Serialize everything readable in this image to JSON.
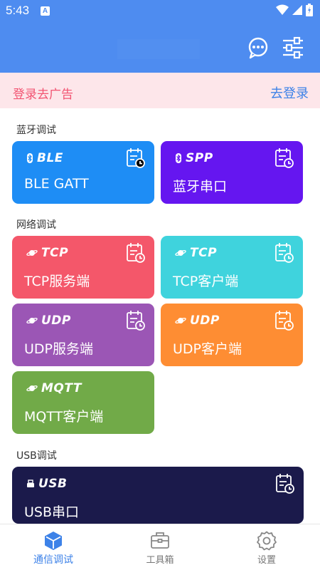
{
  "status_bar": {
    "time": "5:43",
    "notification_badge": "A"
  },
  "app_bar": {
    "title": ""
  },
  "ad_banner": {
    "text": "登录去广告",
    "login_link": "去登录"
  },
  "sections": [
    {
      "title": "蓝牙调试"
    },
    {
      "title": "网络调试"
    },
    {
      "title": "USB调试"
    }
  ],
  "cards": [
    {
      "tag": "BLE",
      "label": "BLE GATT",
      "color": "#1e8df5",
      "tag_icon": "bluetooth-icon"
    },
    {
      "tag": "SPP",
      "label": "蓝牙串口",
      "color": "#6516f0",
      "tag_icon": "bluetooth-icon"
    },
    {
      "tag": "TCP",
      "label": "TCP服务端",
      "color": "#f4576a",
      "tag_icon": "planet-icon"
    },
    {
      "tag": "TCP",
      "label": "TCP客户端",
      "color": "#3fd3dd",
      "tag_icon": "planet-icon"
    },
    {
      "tag": "UDP",
      "label": "UDP服务端",
      "color": "#9b56b5",
      "tag_icon": "planet-icon"
    },
    {
      "tag": "UDP",
      "label": "UDP客户端",
      "color": "#fe8d33",
      "tag_icon": "planet-icon"
    },
    {
      "tag": "MQTT",
      "label": "MQTT客户端",
      "color": "#71aa48",
      "tag_icon": "planet-icon"
    },
    {
      "tag": "USB",
      "label": "USB串口",
      "color": "#1b1a4b",
      "tag_icon": "usb-icon"
    }
  ],
  "bottom_nav": [
    {
      "label": "通信调试",
      "icon": "cube-icon",
      "active": true
    },
    {
      "label": "工具箱",
      "icon": "toolbox-icon",
      "active": false
    },
    {
      "label": "设置",
      "icon": "gear-icon",
      "active": false
    }
  ],
  "colors": {
    "primary": "#4e8cf0",
    "accent_text": "#3d82e8",
    "ad_bg": "#fde6ea",
    "ad_text": "#f25472"
  }
}
